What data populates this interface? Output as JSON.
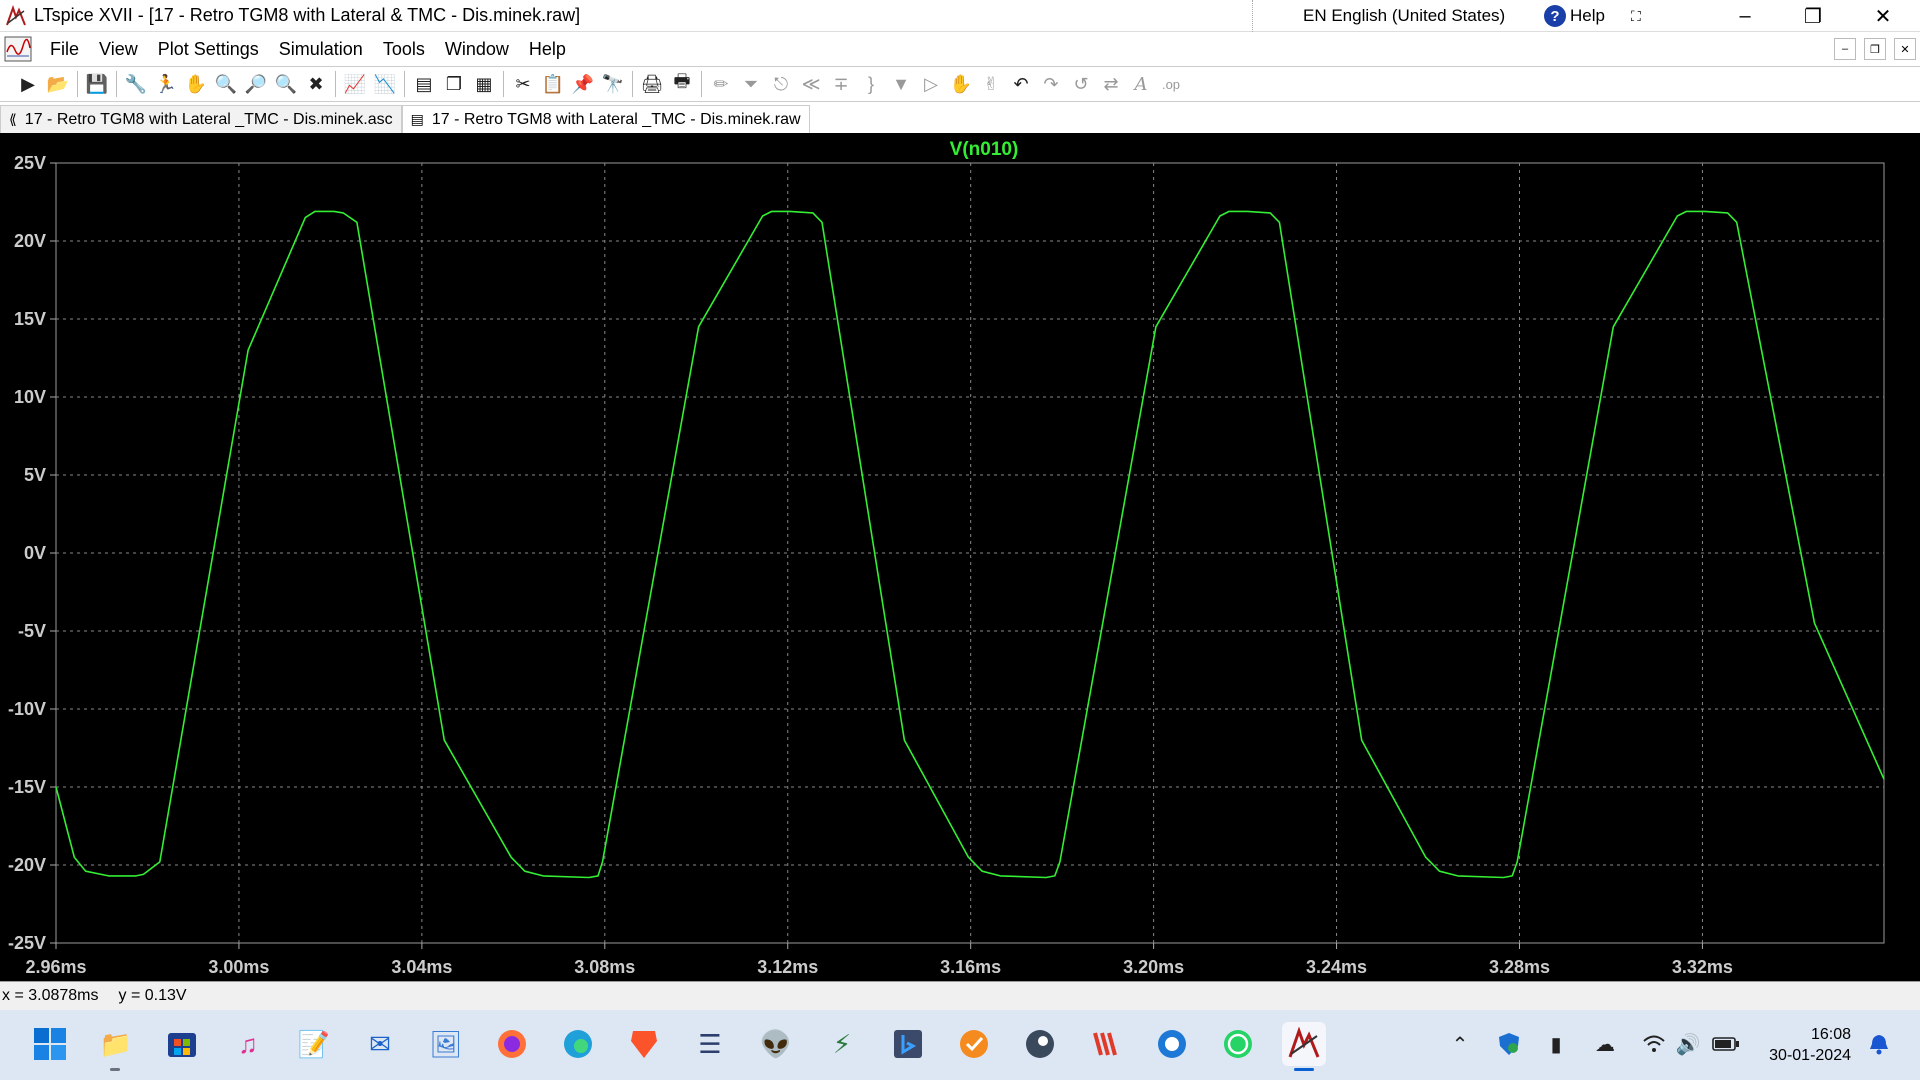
{
  "window": {
    "title": "LTspice XVII - [17 - Retro TGM8 with Lateral & TMC - Dis.minek.raw]",
    "language": "EN English (United States)",
    "help_label": "Help"
  },
  "menu": [
    "File",
    "View",
    "Plot Settings",
    "Simulation",
    "Tools",
    "Window",
    "Help"
  ],
  "tabs": [
    {
      "label": "17 - Retro TGM8 with Lateral _TMC - Dis.minek.asc",
      "icon": "schematic-icon"
    },
    {
      "label": "17 - Retro TGM8 with Lateral _TMC - Dis.minek.raw",
      "icon": "waveform-icon"
    }
  ],
  "status": {
    "x": "x = 3.0878ms",
    "y": "y = 0.13V"
  },
  "clock": {
    "time": "16:08",
    "date": "30-01-2024"
  },
  "colors": {
    "trace": "#33ee33",
    "background": "#000000",
    "grid": "#888888",
    "axis_text": "#cccccc"
  },
  "chart_data": {
    "type": "line",
    "title": "V(n010)",
    "xlabel": "",
    "ylabel": "",
    "xlim": [
      2.96,
      3.3597
    ],
    "ylim": [
      -25,
      25
    ],
    "grid": true,
    "x_ticks": [
      "2.96ms",
      "3.00ms",
      "3.04ms",
      "3.08ms",
      "3.12ms",
      "3.16ms",
      "3.20ms",
      "3.24ms",
      "3.28ms",
      "3.32ms"
    ],
    "y_ticks": [
      "25V",
      "20V",
      "15V",
      "10V",
      "5V",
      "0V",
      "-5V",
      "-10V",
      "-15V",
      "-20V",
      "-25V"
    ],
    "series": [
      {
        "name": "V(n010)",
        "x_unit": "ms",
        "y_unit": "V",
        "x": [
          2.96,
          2.964,
          2.9665,
          2.9715,
          2.9775,
          2.9791,
          2.9827,
          3.002,
          3.0145,
          3.0166,
          3.0208,
          3.0228,
          3.0258,
          3.0449,
          3.0595,
          3.0625,
          3.0665,
          3.0765,
          3.0785,
          3.0795,
          3.1005,
          3.1145,
          3.1165,
          3.1205,
          3.1255,
          3.1275,
          3.1455,
          3.1595,
          3.1625,
          3.1665,
          3.1765,
          3.1784,
          3.1795,
          3.2005,
          3.2145,
          3.2165,
          3.2205,
          3.2255,
          3.2275,
          3.2455,
          3.2595,
          3.2625,
          3.2665,
          3.2765,
          3.2784,
          3.2795,
          3.3005,
          3.3145,
          3.3165,
          3.3205,
          3.3255,
          3.3275,
          3.3445,
          3.3597
        ],
        "y": [
          -15.0,
          -19.5,
          -20.4,
          -20.7,
          -20.7,
          -20.6,
          -19.8,
          13.0,
          21.5,
          21.9,
          21.9,
          21.8,
          21.2,
          -12.0,
          -19.5,
          -20.4,
          -20.7,
          -20.8,
          -20.7,
          -19.8,
          14.5,
          21.6,
          21.9,
          21.9,
          21.8,
          21.2,
          -12.0,
          -19.5,
          -20.4,
          -20.7,
          -20.8,
          -20.7,
          -19.8,
          14.5,
          21.6,
          21.9,
          21.9,
          21.8,
          21.2,
          -12.0,
          -19.5,
          -20.4,
          -20.7,
          -20.8,
          -20.7,
          -19.8,
          14.5,
          21.6,
          21.9,
          21.9,
          21.8,
          21.2,
          -4.5,
          -14.5
        ]
      }
    ]
  },
  "taskbar_icons": [
    "windows-start-icon",
    "file-explorer-icon",
    "microsoft-store-icon",
    "itunes-icon",
    "notepad-icon",
    "mail-icon",
    "photos-icon",
    "firefox-icon",
    "edge-icon",
    "brave-icon",
    "app-icon",
    "alien-icon",
    "network-app-icon",
    "bing-icon",
    "tasks-icon",
    "steam-icon",
    "winamp-icon",
    "shield-app-icon",
    "whatsapp-icon",
    "ltspice-icon"
  ],
  "tray_icons": [
    "chevron-up-icon",
    "defender-icon",
    "usb-icon",
    "onedrive-icon",
    "wifi-icon",
    "volume-icon",
    "battery-icon",
    "notification-bell-icon"
  ]
}
